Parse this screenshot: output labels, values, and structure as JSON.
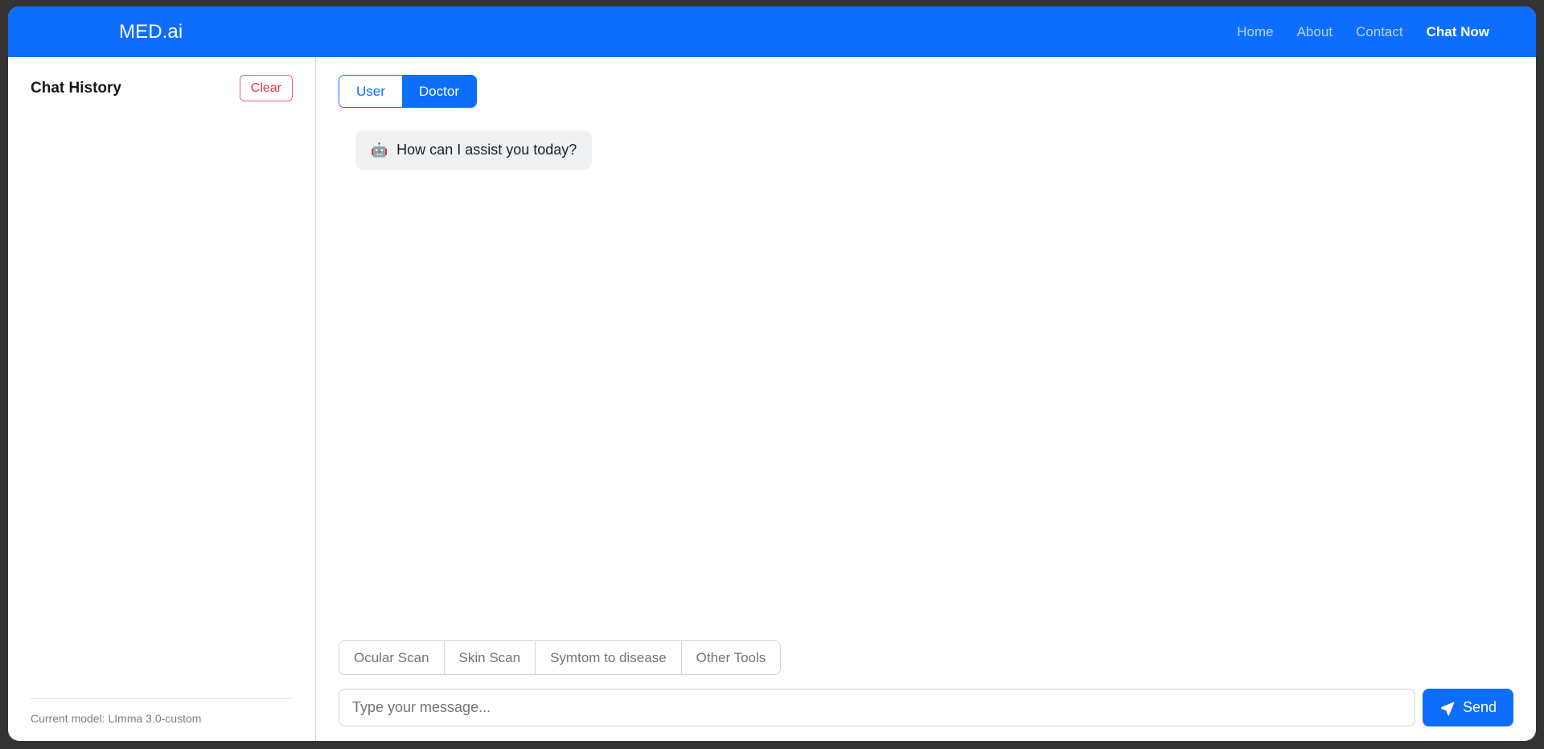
{
  "header": {
    "brand": "MED.ai",
    "nav": [
      {
        "label": "Home",
        "active": false
      },
      {
        "label": "About",
        "active": false
      },
      {
        "label": "Contact",
        "active": false
      },
      {
        "label": "Chat Now",
        "active": true
      }
    ]
  },
  "sidebar": {
    "title": "Chat History",
    "clear_label": "Clear",
    "history_items": [],
    "model_status": "Current model: LImma 3.0-custom"
  },
  "chat": {
    "roles": [
      {
        "label": "User",
        "active": false
      },
      {
        "label": "Doctor",
        "active": true
      }
    ],
    "messages": [
      {
        "icon": "robot-icon",
        "icon_glyph": "🤖",
        "text": "How can I assist you today?",
        "sender": "assistant"
      }
    ],
    "tools": [
      "Ocular Scan",
      "Skin Scan",
      "Symtom to disease",
      "Other Tools"
    ],
    "input_placeholder": "Type your message...",
    "input_value": "",
    "send_label": "Send"
  },
  "colors": {
    "primary": "#0d6efd",
    "danger": "#dc3545",
    "bubble": "#eef0f2",
    "muted": "#6c757d",
    "frame": "#333333"
  }
}
